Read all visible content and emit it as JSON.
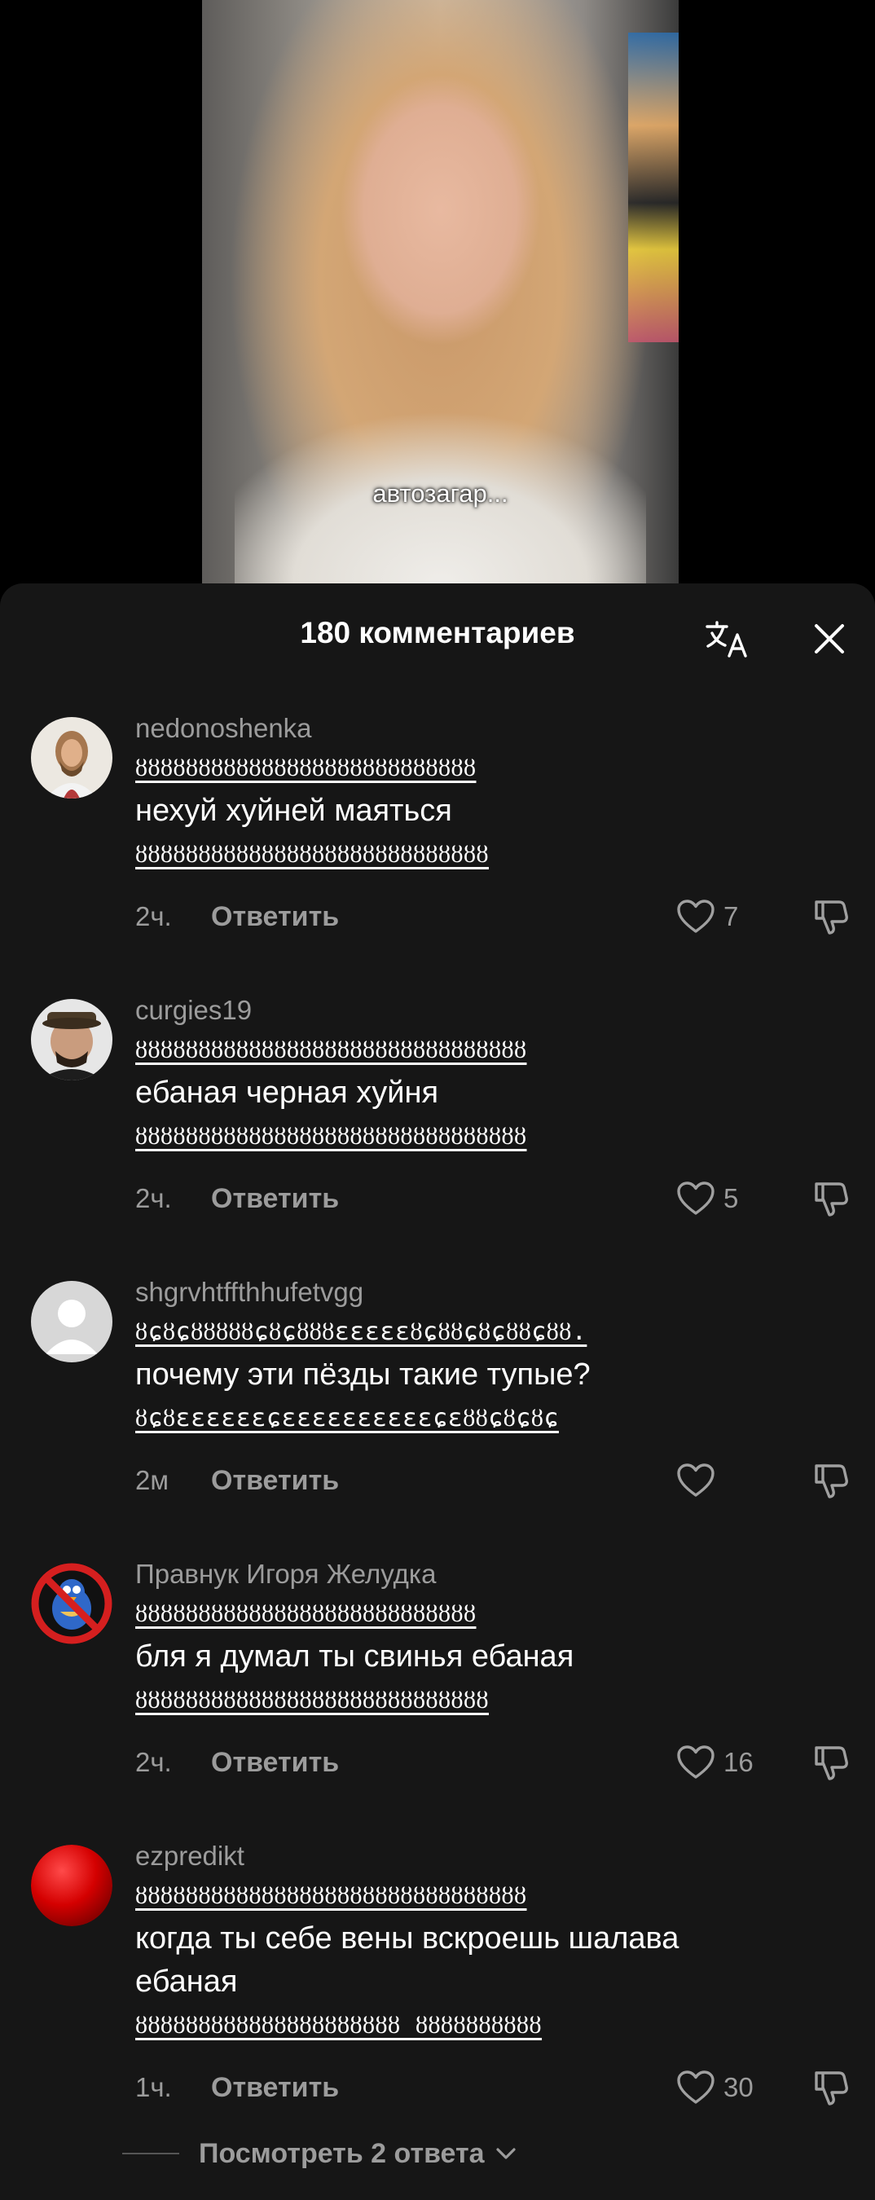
{
  "video": {
    "caption": "автозагар..."
  },
  "sheet": {
    "title": "180 комментариев"
  },
  "comments": [
    {
      "username": "nedonoshenka",
      "lines": [
        "ȣȣȣȣȣȣȣȣȣȣȣȣȣȣȣȣȣȣȣȣȣȣȣȣȣȣȣ",
        "нехуй хуйней маяться",
        "ȣȣȣȣȣȣȣȣȣȣȣȣȣȣȣȣȣȣȣȣȣȣȣȣȣȣȣȣ"
      ],
      "time": "2ч.",
      "reply": "Ответить",
      "likes": "7",
      "avatar_color": "#e9e4dc"
    },
    {
      "username": "curgies19",
      "lines": [
        "ȣȣȣȣȣȣȣȣȣȣȣȣȣȣȣȣȣȣȣȣȣȣȣȣȣȣȣȣȣȣȣ",
        "ебаная черная хуйня",
        "ȣȣȣȣȣȣȣȣȣȣȣȣȣȣȣȣȣȣȣȣȣȣȣȣȣȣȣȣȣȣȣ"
      ],
      "time": "2ч.",
      "reply": "Ответить",
      "likes": "5",
      "avatar_color": "#dcdcdc"
    },
    {
      "username": "shgrvhtffthhufetvgg",
      "lines": [
        "ȣɕȣɕȣȣȣȣȣɕȣɕȣȣȣɛɛɛɛɛȣɕȣȣɕȣɕȣȣɕȣȣ.",
        "почему эти пёзды такие тупые?",
        "ȣɕȣɛɛɛɛɛɛɕɛɛɛɛɛɛɛɛɛɛɕɛȣȣɕȣɕȣɕ"
      ],
      "time": "2м",
      "reply": "Ответить",
      "likes": "",
      "avatar_color": "#d8d8d8"
    },
    {
      "username": "Правнук Игоря Желудка",
      "lines": [
        "ȣȣȣȣȣȣȣȣȣȣȣȣȣȣȣȣȣȣȣȣȣȣȣȣȣȣȣ",
        "бля я думал ты свинья ебаная",
        "ȣȣȣȣȣȣȣȣȣȣȣȣȣȣȣȣȣȣȣȣȣȣȣȣȣȣȣȣ"
      ],
      "time": "2ч.",
      "reply": "Ответить",
      "likes": "16",
      "avatar_color": "#d32b2b"
    },
    {
      "username": "ezpredikt",
      "lines": [
        "ȣȣȣȣȣȣȣȣȣȣȣȣȣȣȣȣȣȣȣȣȣȣȣȣȣȣȣȣȣȣȣ",
        "когда ты себе вены вскроешь шалава",
        "ебаная",
        "ȣȣȣȣȣȣȣȣȣȣȣȣȣȣȣȣȣȣȣȣȣ ȣȣȣȣȣȣȣȣȣȣ"
      ],
      "time": "1ч.",
      "reply": "Ответить",
      "likes": "30",
      "avatar_color": "#d40000"
    }
  ],
  "view_replies": "Посмотреть 2 ответа"
}
